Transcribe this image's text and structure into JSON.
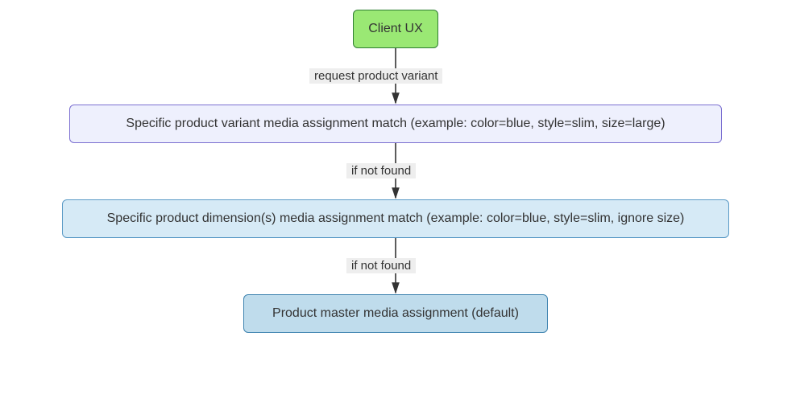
{
  "nodes": {
    "client_ux": "Client UX",
    "variant_match": "Specific product variant media assignment match (example: color=blue, style=slim, size=large)",
    "dimension_match": "Specific product dimension(s) media assignment match (example: color=blue, style=slim, ignore size)",
    "master_default": "Product master media assignment (default)"
  },
  "edges": {
    "request_variant": "request product variant",
    "if_not_found_1": "if not found",
    "if_not_found_2": "if not found"
  }
}
